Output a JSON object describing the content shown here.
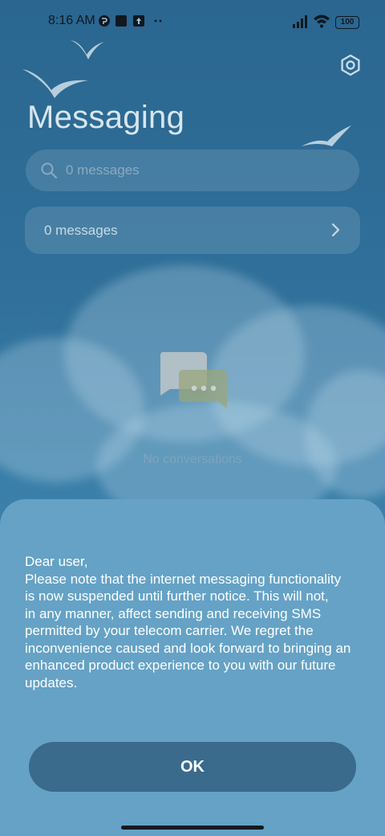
{
  "status_bar": {
    "time": "8:16 AM",
    "battery": "100"
  },
  "header": {
    "title": "Messaging",
    "settings_icon": "gear-icon"
  },
  "search": {
    "placeholder": "0 messages",
    "icon": "search-icon"
  },
  "summary_card": {
    "label": "0 messages",
    "icon": "chevron-right-icon"
  },
  "empty_state": {
    "icon": "chat-bubbles-icon",
    "text": "No conversations"
  },
  "dialog": {
    "lines": [
      "Dear user,",
      "Please note that the internet messaging functionality",
      "is now suspended until further notice. This will not,",
      "in any manner, affect sending and receiving SMS",
      "permitted by your telecom carrier. We regret the",
      "inconvenience caused and look forward to bringing an",
      "enhanced product experience to you with our future",
      "updates."
    ],
    "ok_label": "OK"
  },
  "colors": {
    "background": "#2f6f99",
    "sheet": "#65a2c6",
    "button": "#3a6a8c"
  }
}
